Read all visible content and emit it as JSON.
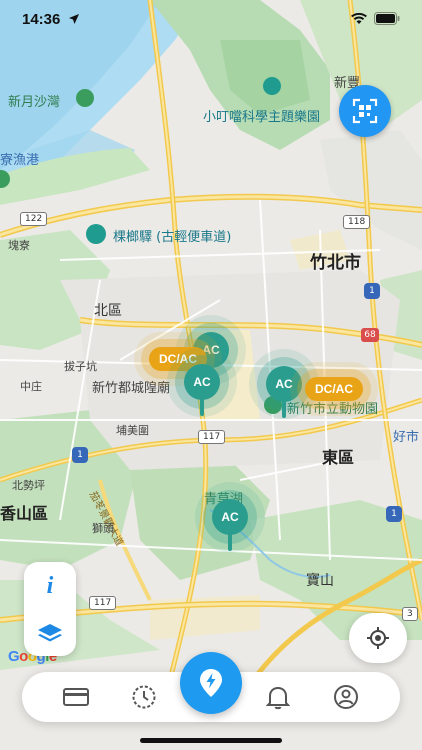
{
  "status": {
    "time": "14:36"
  },
  "map": {
    "labels": {
      "xinfeng": "新豐",
      "xinyue_bay": "新月沙灣",
      "xiaodingdang": "小叮噹科學主題樂園",
      "fishing_port": "寮漁港",
      "tree_station": "棵榔驛 (古輕便車道)",
      "jingcuo": "塊寮",
      "zhubei_city": "竹北市",
      "north_district": "北區",
      "xinzhu": "新竹",
      "zhongzhuang": "中庄",
      "bazikeng": "拔子坑",
      "temple": "新竹都城隍廟",
      "zoo": "新竹市立動物園",
      "putian": "埔美圍",
      "east_district": "東區",
      "haowu": "好市",
      "beiwuzhen": "北勢坪",
      "xiangshan": "香山區",
      "liuqiu": "獅頭",
      "qingcao_lake": "青草湖",
      "baoshan": "寶山",
      "scenic_road": "茄苳景觀大道"
    },
    "shields": {
      "r122": "122",
      "r118": "118",
      "r117a": "117",
      "r117b": "117",
      "h1a": "1",
      "h1b": "1",
      "h1c": "1",
      "h3": "3",
      "h68": "68"
    },
    "google": "Google"
  },
  "markers": {
    "ac_label": "AC",
    "dcac_label": "DC/AC"
  },
  "colors": {
    "primary_blue": "#1e9bf0",
    "marker_ac": "#2a9d8f",
    "marker_dcac": "#e8a316"
  },
  "icons": {
    "scan": "qr-scan-icon",
    "info": "info-icon",
    "layers": "layers-icon",
    "locate": "crosshair-locate-icon",
    "card": "card-icon",
    "history": "clock-icon",
    "charge": "lightning-icon",
    "notifications": "bell-icon",
    "profile": "user-icon"
  },
  "panel": {
    "info_glyph": "i"
  }
}
